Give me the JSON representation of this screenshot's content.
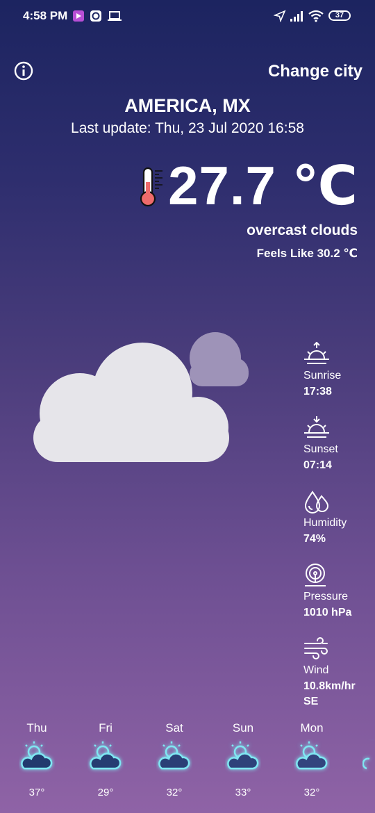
{
  "status_bar": {
    "time": "4:58 PM",
    "battery": "37",
    "icons": [
      "media-app-icon",
      "circle-app-icon",
      "laptop-icon",
      "location-arrow-icon",
      "signal-icon",
      "wifi-icon",
      "battery-icon"
    ]
  },
  "header": {
    "change_city": "Change city",
    "city": "AMERICA, MX",
    "last_update": "Last update: Thu, 23 Jul 2020 16:58"
  },
  "current": {
    "temperature": "27.7 ℃",
    "description": "overcast clouds",
    "feels_like": "Feels Like 30.2 ℃"
  },
  "details": [
    {
      "label": "Sunrise",
      "value": "17:38",
      "icon": "sunrise-icon"
    },
    {
      "label": "Sunset",
      "value": "07:14",
      "icon": "sunset-icon"
    },
    {
      "label": "Humidity",
      "value": "74%",
      "icon": "humidity-icon"
    },
    {
      "label": "Pressure",
      "value": "1010 hPa",
      "icon": "pressure-icon"
    },
    {
      "label": "Wind",
      "value": "10.8km/hr",
      "value2": "SE",
      "icon": "wind-icon"
    }
  ],
  "forecast": [
    {
      "day": "Thu",
      "temp": "37°"
    },
    {
      "day": "Fri",
      "temp": "29°"
    },
    {
      "day": "Sat",
      "temp": "32°"
    },
    {
      "day": "Sun",
      "temp": "33°"
    },
    {
      "day": "Mon",
      "temp": "32°"
    }
  ],
  "colors": {
    "gradient_top": "#1c2460",
    "gradient_bottom": "#8f63a6",
    "cloud_front": "#e6e5ea",
    "cloud_back": "#9e93b8",
    "forecast_icon_glow": "#7fe7f2",
    "thermometer_fill": "#ef6b6b"
  }
}
